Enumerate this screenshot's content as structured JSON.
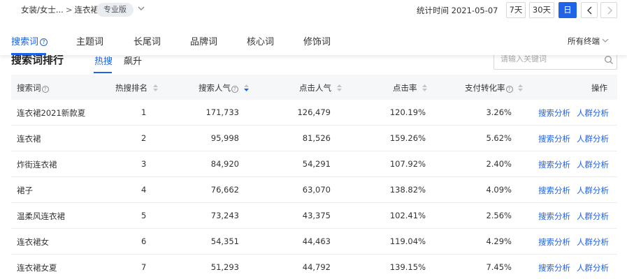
{
  "breadcrumb": {
    "category": "女装/女士...",
    "separator": ">",
    "current": "连衣裙",
    "edition_badge": "专业版"
  },
  "header": {
    "stat_time_label": "统计时间 2021-05-07",
    "periods": [
      "7天",
      "30天",
      "日"
    ],
    "active_period": "日"
  },
  "tabs": {
    "items": [
      "搜索词",
      "主题词",
      "长尾词",
      "品牌词",
      "核心词",
      "修饰词"
    ],
    "help_mark": "?",
    "terminal_label": "所有终端"
  },
  "section": {
    "title": "搜索词排行",
    "sub_tabs": [
      "热搜",
      "飙升"
    ],
    "search_placeholder": "请输入关键词"
  },
  "table": {
    "headers": {
      "keyword": "搜索词",
      "rank": "热搜排名",
      "popularity": "搜索人气",
      "clicks": "点击人气",
      "ctr": "点击率",
      "conversion": "支付转化率",
      "actions": "操作"
    },
    "action_labels": {
      "analysis": "搜索分析",
      "crowd": "人群分析"
    },
    "rows": [
      {
        "keyword": "连衣裙2021新款夏",
        "rank": "1",
        "popularity": "171,733",
        "clicks": "126,479",
        "ctr": "120.19%",
        "conversion": "3.26%"
      },
      {
        "keyword": "连衣裙",
        "rank": "2",
        "popularity": "95,998",
        "clicks": "81,526",
        "ctr": "159.26%",
        "conversion": "5.62%"
      },
      {
        "keyword": "炸街连衣裙",
        "rank": "3",
        "popularity": "84,920",
        "clicks": "54,291",
        "ctr": "107.92%",
        "conversion": "2.40%"
      },
      {
        "keyword": "裙子",
        "rank": "4",
        "popularity": "76,662",
        "clicks": "63,070",
        "ctr": "138.82%",
        "conversion": "4.09%"
      },
      {
        "keyword": "温柔风连衣裙",
        "rank": "5",
        "popularity": "73,243",
        "clicks": "43,375",
        "ctr": "102.41%",
        "conversion": "2.56%"
      },
      {
        "keyword": "连衣裙女",
        "rank": "6",
        "popularity": "54,351",
        "clicks": "44,463",
        "ctr": "119.04%",
        "conversion": "4.29%"
      },
      {
        "keyword": "连衣裙女夏",
        "rank": "7",
        "popularity": "51,293",
        "clicks": "44,792",
        "ctr": "139.15%",
        "conversion": "7.45%"
      }
    ]
  },
  "colors": {
    "accent": "#1f63e8",
    "header_bg": "#f6f7f9",
    "badge_bg": "#e9ecf1"
  }
}
